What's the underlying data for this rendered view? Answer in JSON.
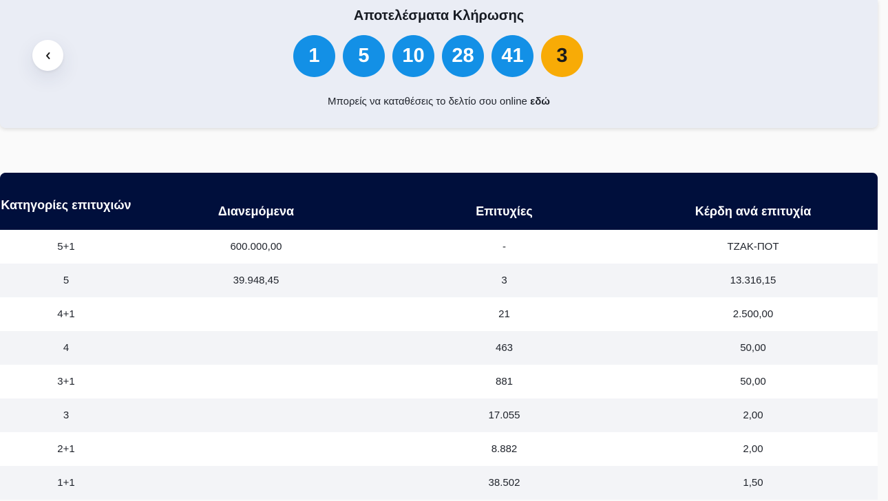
{
  "header": {
    "title": "Αποτελέσματα Κλήρωσης",
    "numbers": [
      "1",
      "5",
      "10",
      "28",
      "41"
    ],
    "joker": "3",
    "online_text": "Μπορείς να καταθέσεις το δελτίο σου online ",
    "online_link": "εδώ"
  },
  "table": {
    "headers": [
      "Κατηγορίες επιτυχιών",
      "Διανεμόμενα",
      "Επιτυχίες",
      "Κέρδη ανά επιτυχία"
    ],
    "rows": [
      [
        "5+1",
        "600.000,00",
        "-",
        "ΤΖΑΚ-ΠΟΤ"
      ],
      [
        "5",
        "39.948,45",
        "3",
        "13.316,15"
      ],
      [
        "4+1",
        "",
        "21",
        "2.500,00"
      ],
      [
        "4",
        "",
        "463",
        "50,00"
      ],
      [
        "3+1",
        "",
        "881",
        "50,00"
      ],
      [
        "3",
        "",
        "17.055",
        "2,00"
      ],
      [
        "2+1",
        "",
        "8.882",
        "2,00"
      ],
      [
        "1+1",
        "",
        "38.502",
        "1,50"
      ]
    ]
  },
  "colors": {
    "ball_main": "#1390e6",
    "ball_joker": "#f8ab06",
    "table_header": "#000f3c"
  }
}
